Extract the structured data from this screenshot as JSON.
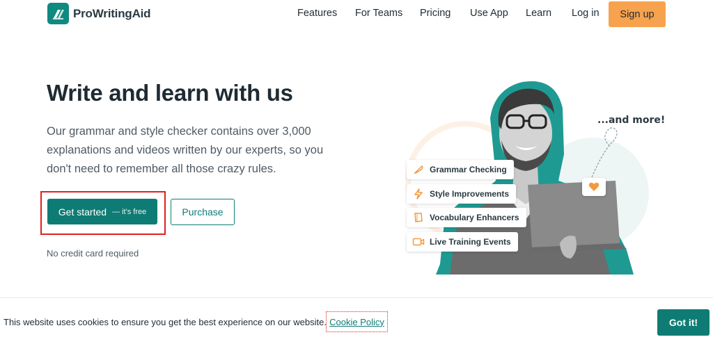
{
  "brand": {
    "name": "ProWritingAid"
  },
  "nav": {
    "items": [
      "Features",
      "For Teams",
      "Pricing",
      "Use App",
      "Learn",
      "Log in"
    ],
    "signup_label": "Sign up"
  },
  "hero": {
    "title": "Write and learn with us",
    "description": "Our grammar and style checker contains over 3,000 explanations and videos written by our experts, so you don't need to remember all those crazy rules.",
    "primary_label": "Get started",
    "primary_sublabel": "— it's free",
    "secondary_label": "Purchase",
    "note": "No credit card required"
  },
  "features": {
    "items": [
      {
        "label": "Grammar Checking",
        "icon": "feather-pen-icon"
      },
      {
        "label": "Style Improvements",
        "icon": "lightning-icon"
      },
      {
        "label": "Vocabulary Enhancers",
        "icon": "book-icon"
      },
      {
        "label": "Live Training Events",
        "icon": "video-camera-icon"
      }
    ],
    "more_label": "...and more!"
  },
  "cookie": {
    "message": "This website uses cookies to ensure you get the best experience on our website.",
    "link_label": "Cookie Policy",
    "accept_label": "Got it!"
  },
  "colors": {
    "brand_teal": "#0e7c74",
    "signup_orange": "#f7a24e",
    "accent_orange": "#f39a3c",
    "highlight_red": "#e0201e"
  }
}
